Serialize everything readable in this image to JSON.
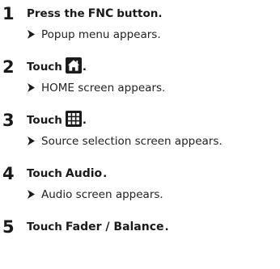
{
  "steps": [
    {
      "number": "1",
      "text": "Press the",
      "key": "FNC",
      "suffix": "button.",
      "result": "Popup menu appears."
    },
    {
      "number": "2",
      "text": "Touch",
      "icon": "home-icon",
      "suffix": ".",
      "result": "HOME screen appears."
    },
    {
      "number": "3",
      "text": "Touch",
      "icon": "grid-icon",
      "suffix": ".",
      "result": "Source selection screen appears."
    },
    {
      "number": "4",
      "text": "Touch",
      "key": "Audio",
      "suffix": ".",
      "result": "Audio screen appears."
    },
    {
      "number": "5",
      "text": "Touch",
      "key": "Fader / Balance",
      "suffix": "."
    }
  ],
  "colors": {
    "text": "#1a1a1a",
    "icon_bg": "#1b1b1b",
    "icon_fg": "#ffffff"
  },
  "icons": {
    "result_marker": "right-arrowhead-icon"
  }
}
